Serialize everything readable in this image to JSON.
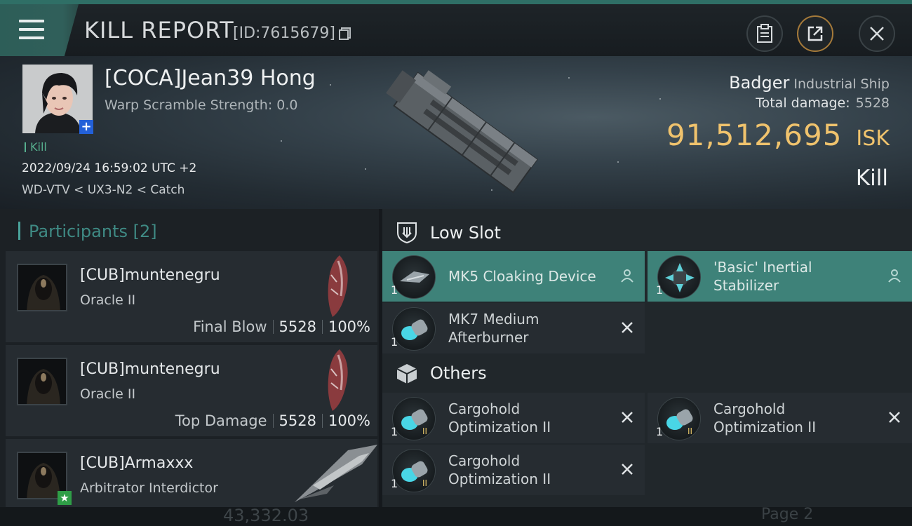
{
  "header": {
    "title": "KILL REPORT",
    "kill_id": "[ID:7615679]"
  },
  "victim": {
    "name": "[COCA]Jean39 Hong",
    "warp_scramble": "Warp Scramble Strength: 0.0",
    "tag": "Kill",
    "datetime": "2022/09/24 16:59:02 UTC +2",
    "location": "WD-VTV < UX3-N2 < Catch",
    "ship_name": "Badger",
    "ship_class": "Industrial Ship",
    "total_damage_label": "Total damage:",
    "total_damage": "5528",
    "isk_value": "91,512,695",
    "isk_unit": "ISK",
    "result": "Kill"
  },
  "participants": {
    "label": "Participants [2]",
    "items": [
      {
        "name": "[CUB]muntenegru",
        "ship": "Oracle II",
        "role": "Final Blow",
        "damage": "5528",
        "percent": "100%"
      },
      {
        "name": "[CUB]muntenegru",
        "ship": "Oracle II",
        "role": "Top Damage",
        "damage": "5528",
        "percent": "100%"
      },
      {
        "name": "[CUB]Armaxxx",
        "ship": "Arbitrator Interdictor"
      }
    ]
  },
  "low_slot": {
    "title": "Low Slot",
    "modules": [
      {
        "name": "MK5 Cloaking Device",
        "qty": "1",
        "status": "person-icon"
      },
      {
        "name": "'Basic' Inertial\nStabilizer",
        "qty": "1",
        "status": "person-icon"
      },
      {
        "name": "MK7 Medium\nAfterburner",
        "qty": "1",
        "status": "destroyed-icon"
      }
    ]
  },
  "others": {
    "title": "Others",
    "modules": [
      {
        "name": "Cargohold\nOptimization II",
        "qty": "1",
        "status": "destroyed-icon"
      },
      {
        "name": "Cargohold\nOptimization II",
        "qty": "1",
        "status": "destroyed-icon"
      },
      {
        "name": "Cargohold\nOptimization II",
        "qty": "1",
        "status": "destroyed-icon"
      }
    ]
  },
  "footer": {
    "ghost_value": "43,332.03",
    "ghost_page": "Page 2"
  },
  "colors": {
    "accent_teal": "#3e8279",
    "isk_gold": "#f0c36d",
    "badge_blue": "#2360d8",
    "badge_green": "#2f9e47"
  }
}
